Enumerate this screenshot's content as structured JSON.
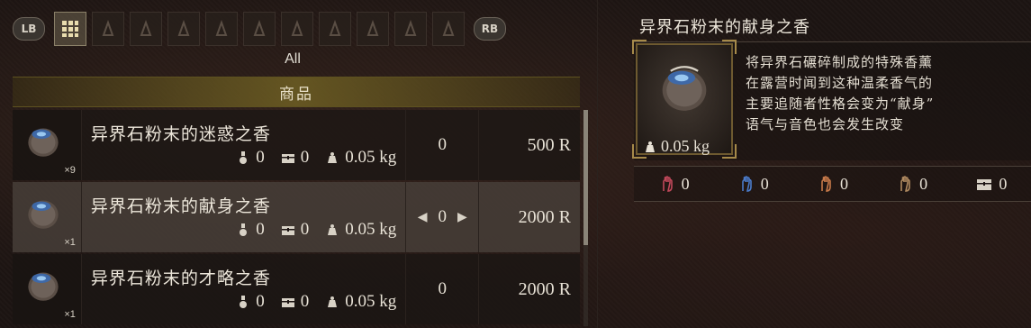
{
  "tabbar": {
    "lb_label": "LB",
    "rb_label": "RB",
    "tab_icons": [
      "grid-icon",
      "flask-icon",
      "scroll-icon",
      "herb-icon",
      "claw-icon",
      "blade-icon",
      "shell-icon",
      "stone-icon",
      "statue-icon",
      "feather-icon",
      "horn-icon"
    ],
    "active_index": 0
  },
  "filter_label": "All",
  "section_header": "商品",
  "items": [
    {
      "name": "异界石粉末的迷惑之香",
      "quantity": "×9",
      "stat1": "0",
      "stat2": "0",
      "weight": "0.05 kg",
      "count": "0",
      "price": "500 R",
      "selected": false
    },
    {
      "name": "异界石粉末的献身之香",
      "quantity": "×1",
      "stat1": "0",
      "stat2": "0",
      "weight": "0.05 kg",
      "count": "0",
      "price": "2000 R",
      "selected": true
    },
    {
      "name": "异界石粉末的才略之香",
      "quantity": "×1",
      "stat1": "0",
      "stat2": "0",
      "weight": "0.05 kg",
      "count": "0",
      "price": "2000 R",
      "selected": false
    }
  ],
  "detail": {
    "title": "异界石粉末的献身之香",
    "description_lines": [
      "将异界石碾碎制成的特殊香薰",
      "在露营时闻到这种温柔香气的",
      "主要追随者性格会变为“献身”",
      "语气与音色也会发生改变"
    ],
    "weight": "0.05 kg",
    "attributes": [
      {
        "icon": "red-hand-icon",
        "value": "0",
        "color": "#c0485a"
      },
      {
        "icon": "blue-hand-icon",
        "value": "0",
        "color": "#4a7ac8"
      },
      {
        "icon": "orange-hand-icon",
        "value": "0",
        "color": "#c87a4a"
      },
      {
        "icon": "tan-hand-icon",
        "value": "0",
        "color": "#b08a60"
      },
      {
        "icon": "chest-icon",
        "value": "0",
        "color": "#d8d2c6"
      }
    ]
  },
  "colors": {
    "accent_gold": "#a68a4a",
    "selected_row": "#46403a"
  }
}
